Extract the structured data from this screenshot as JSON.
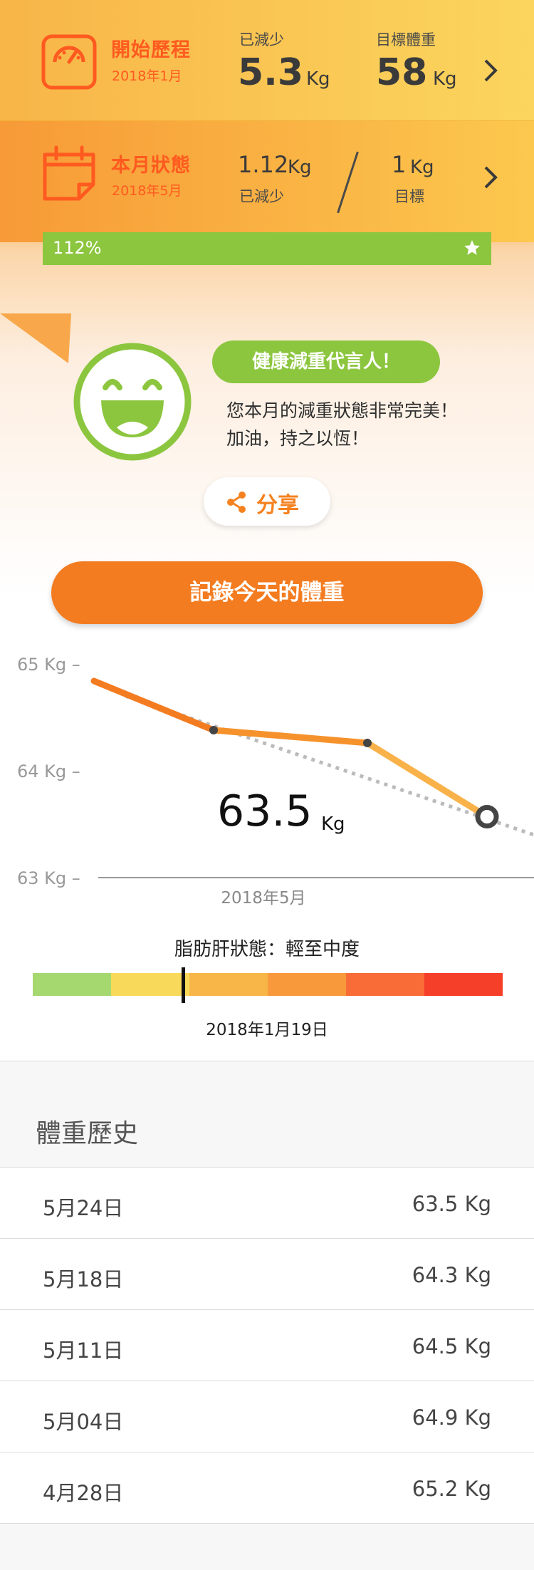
{
  "journey": {
    "title": "開始歷程",
    "date": "2018年1月",
    "lost_label": "已減少",
    "lost_value": "5.3",
    "lost_unit": "Kg",
    "target_label": "目標體重",
    "target_value": "58",
    "target_unit": "Kg"
  },
  "monthly": {
    "title": "本月狀態",
    "date": "2018年5月",
    "lost_value": "1.12",
    "lost_unit": "Kg",
    "lost_label": "已減少",
    "goal_value": "1",
    "goal_unit": "Kg",
    "goal_label": "目標"
  },
  "progress": {
    "label": "112%",
    "percent": 112
  },
  "message": {
    "badge": "健康減重代言人！",
    "line1": "您本月的減重狀態非常完美！",
    "line2": "加油，持之以恆！",
    "share_label": "分享"
  },
  "record_button": "記錄今天的體重",
  "chart_data": {
    "type": "line",
    "y_ticks": [
      "65 Kg –",
      "64 Kg –",
      "63 Kg –"
    ],
    "ylim": [
      63,
      65
    ],
    "x_label": "2018年5月",
    "series": [
      {
        "values": [
          64.84,
          64.38,
          64.26,
          63.57
        ]
      }
    ],
    "trend": [
      64.7,
      63.4
    ],
    "current_value": "63.5",
    "current_unit": "Kg"
  },
  "fat_liver": {
    "title": "脂肪肝狀態：輕至中度",
    "date": "2018年1月19日",
    "level_fraction": 0.32,
    "colors": [
      "#a5d86f",
      "#f9d959",
      "#f8b548",
      "#f89a3c",
      "#f96c38",
      "#f63f28"
    ]
  },
  "history": {
    "title": "體重歷史",
    "rows": [
      {
        "date": "5月24日",
        "weight": "63.5 Kg"
      },
      {
        "date": "5月18日",
        "weight": "64.3 Kg"
      },
      {
        "date": "5月11日",
        "weight": "64.5 Kg"
      },
      {
        "date": "5月04日",
        "weight": "64.9 Kg"
      },
      {
        "date": "4月28日",
        "weight": "65.2 Kg"
      }
    ]
  },
  "colors": {
    "accent": "#f47c20",
    "green": "#8cc63f",
    "title_red": "#ff5a1f"
  }
}
